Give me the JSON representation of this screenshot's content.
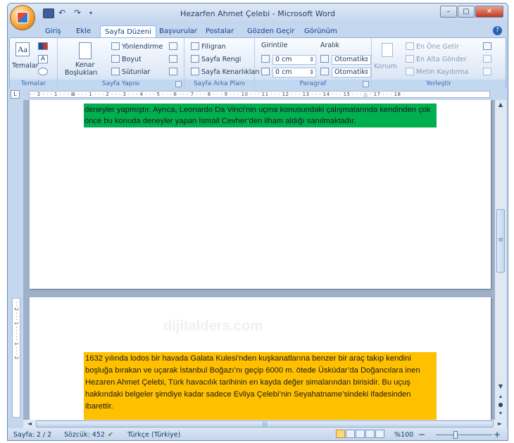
{
  "window": {
    "title": "Hezarfen Ahmet Çelebi - Microsoft Word",
    "controls": {
      "minimize": "–",
      "maximize": "□",
      "close": "✕"
    }
  },
  "quick_access": [
    "save-icon",
    "undo-icon",
    "redo-icon",
    "customize-icon"
  ],
  "tabs": [
    "Giriş",
    "Ekle",
    "Sayfa Düzeni",
    "Başvurular",
    "Postalar",
    "Gözden Geçir",
    "Görünüm"
  ],
  "active_tab": "Sayfa Düzeni",
  "help": "?",
  "ribbon": {
    "temalar": {
      "label": "Temalar",
      "button": "Temalar"
    },
    "sayfa_yapisi": {
      "label": "Sayfa Yapısı",
      "kenar": "Kenar",
      "bosluklari": "Boşlukları",
      "yonlendirme": "Yönlendirme",
      "boyut": "Boyut",
      "sutunlar": "Sütunlar"
    },
    "sayfa_arka_plani": {
      "label": "Sayfa Arka Planı",
      "filigran": "Filigran",
      "sayfa_rengi": "Sayfa Rengi",
      "sayfa_kenarliklari": "Sayfa Kenarlıkları"
    },
    "paragraf": {
      "label": "Paragraf",
      "girintile": "Girintile",
      "aralik": "Aralık",
      "girinti_sol": "0 cm",
      "girinti_sag": "0 cm",
      "aralik_once": "Otomatik",
      "aralik_sonra": "Otomatik"
    },
    "yerlestir": {
      "label": "Yerleştir",
      "konum": "Konum",
      "en_one_getir": "En Öne Getir",
      "en_alta_gonder": "En Alta Gönder",
      "metin_kaydirma": "Metin Kaydırma"
    }
  },
  "ruler": {
    "marks": "· · 2 · · · 1 · · · ⊠ · · · 1 · · · 2 · · · 3 · · · 4 · · · 5 · · · 6 · · · 7 · · · 8 · · · 9 · · · 10 · · · 11 · · · 12 · · · 13 · · · 14 · · · 15 · · · △ · 17 · · · 18 ·",
    "vertical_marks": "· · 2 · · · 1 · · · · · 1 · · · 2"
  },
  "document": {
    "page1_text": "deneyler yapmıştır. Ayrıca, Leonardo Da Vinci’nin uçma konusundaki  çalışmalarında kendinden çok önce bu konuda  deneyler yapan İsmail Cevher’den ilham aldığı sanılmaktadır.",
    "page2_text": "1632 yılında lodos bir havada Galata Kulesi’nden kuşkanatlarına benzer bir araç takıp kendini boşluğa bırakan ve uçarak İstanbul  Boğazı’nı geçip 6000 m. ötede Üsküdar’da Doğancılara inen Hezaren Ahmet Çelebi, Türk havacılık tarihinin en kayda değer simalarından birisidir. Bu uçuş hakkındaki  belgeler şimdiye kadar sadece Evliya Çelebi’nin Seyahatname’sindeki ifadesinden ibarettir.",
    "watermark": "dijitalders.com",
    "highlight_colors": {
      "green": "#00b050",
      "yellow": "#ffc000"
    }
  },
  "status": {
    "page": "Sayfa: 2 / 2",
    "words": "Sözcük: 452",
    "language": "Türkçe (Türkiye)",
    "zoom": "%100",
    "zoom_minus": "−",
    "zoom_plus": "+",
    "zoom_level": 100
  },
  "scroll": {
    "up": "▲",
    "down": "▼",
    "grip": "≡",
    "hgrip": "|||",
    "left": "◄",
    "right": "►"
  }
}
